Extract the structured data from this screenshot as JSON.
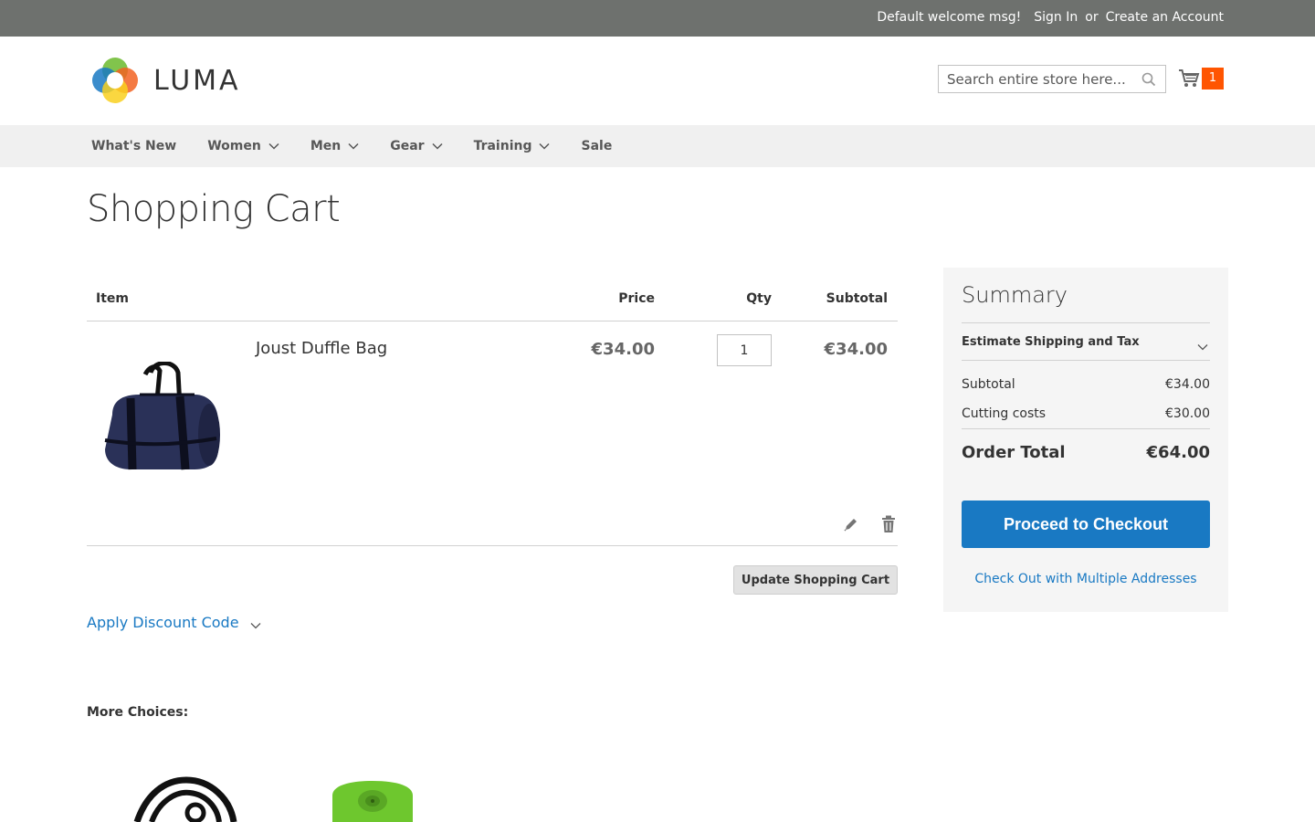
{
  "header": {
    "welcome": "Default welcome msg!",
    "sign_in": "Sign In",
    "or": "or",
    "create_account": "Create an Account",
    "logo_text": "LUMA",
    "search_placeholder": "Search entire store here...",
    "cart_count": "1"
  },
  "nav": {
    "items": [
      {
        "label": "What's New",
        "has_dropdown": false
      },
      {
        "label": "Women",
        "has_dropdown": true
      },
      {
        "label": "Men",
        "has_dropdown": true
      },
      {
        "label": "Gear",
        "has_dropdown": true
      },
      {
        "label": "Training",
        "has_dropdown": true
      },
      {
        "label": "Sale",
        "has_dropdown": false
      }
    ]
  },
  "page": {
    "title": "Shopping Cart"
  },
  "cart": {
    "columns": {
      "item": "Item",
      "price": "Price",
      "qty": "Qty",
      "subtotal": "Subtotal"
    },
    "items": [
      {
        "name": "Joust Duffle Bag",
        "price": "€34.00",
        "qty": "1",
        "subtotal": "€34.00"
      }
    ],
    "update_button": "Update Shopping Cart",
    "discount_label": "Apply Discount Code",
    "more_choices": "More Choices:"
  },
  "summary": {
    "title": "Summary",
    "estimate_label": "Estimate Shipping and Tax",
    "subtotal_label": "Subtotal",
    "subtotal_value": "€34.00",
    "shipping_label": "Cutting costs",
    "shipping_value": "€30.00",
    "total_label": "Order Total",
    "total_value": "€64.00",
    "checkout_button": "Proceed to Checkout",
    "multi_address_link": "Check Out with Multiple Addresses"
  },
  "colors": {
    "topbar": "#6e716e",
    "accent": "#1979c3",
    "cart_badge": "#ff5501",
    "nav_bg": "#f0f0f0"
  }
}
